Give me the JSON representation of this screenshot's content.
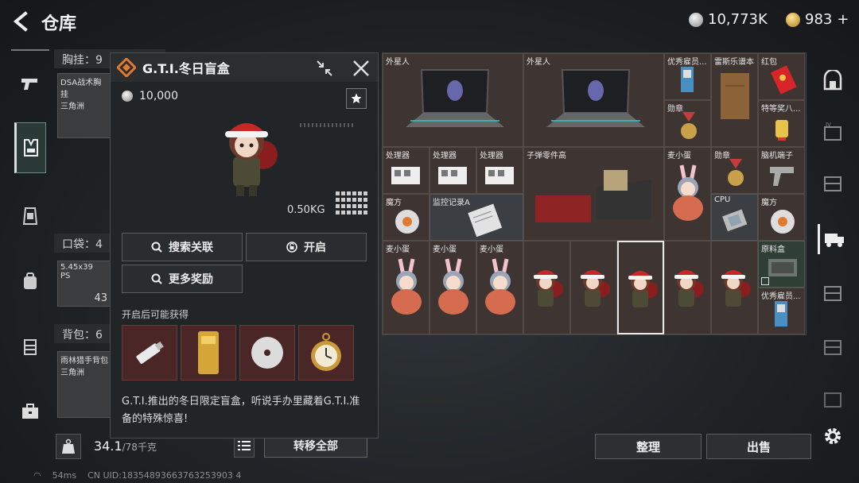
{
  "header": {
    "title": "仓库"
  },
  "currency": {
    "silver": "10,773K",
    "gold": "983",
    "plus": "+"
  },
  "equipment": {
    "chest_label": "胸挂：9",
    "chest_slot": "DSA战术胸挂\n三角洲",
    "pocket_label": "口袋：4",
    "pocket_slot": "5.45x39",
    "pocket_slot_sub": "PS",
    "pocket_count": "43",
    "backpack_label": "背包：6",
    "backpack_slot": "雨林猎手背包\n三角洲"
  },
  "popup": {
    "title": "G.T.I.冬日盲盒",
    "price": "10,000",
    "weight": "0.50KG",
    "search_related": "搜索关联",
    "open": "开启",
    "more_rewards": "更多奖励",
    "rewards_title": "开启后可能获得",
    "description": "G.T.I.推出的冬日限定盲盒，听说手办里藏着G.T.I.准备的特殊惊喜!",
    "rewards": [
      "usb-drive",
      "gold-bar",
      "disc",
      "pocket-watch"
    ]
  },
  "weight_bar": {
    "current": "34.1",
    "max": "/78千克",
    "transfer_all": "转移全部"
  },
  "status": {
    "ping": "54ms",
    "uid": "CN UID:18354893663763253903 4"
  },
  "warehouse": {
    "items": [
      {
        "label": "外星人"
      },
      {
        "label": "外星人"
      },
      {
        "label": "优秀雇员..."
      },
      {
        "label": "雷斯乐谱本"
      },
      {
        "label": "红包"
      },
      {
        "label": "勋章"
      },
      {
        "label": "特等奖八..."
      },
      {
        "label": "处理器"
      },
      {
        "label": "处理器"
      },
      {
        "label": "处理器"
      },
      {
        "label": "子弹零件高"
      },
      {
        "label": "麦小蛋"
      },
      {
        "label": "勋章"
      },
      {
        "label": "脑机端子"
      },
      {
        "label": "魔方"
      },
      {
        "label": "监控记录A"
      },
      {
        "label": "CPU"
      },
      {
        "label": "魔方"
      },
      {
        "label": "麦小蛋"
      },
      {
        "label": "麦小蛋"
      },
      {
        "label": "麦小蛋"
      },
      {
        "label": "原料盒"
      },
      {
        "label": "优秀雇员..."
      }
    ]
  },
  "actions": {
    "organize": "整理",
    "sell": "出售"
  },
  "colors": {
    "reward_bg": "#4a2626",
    "selected_border": "#e8e8e8",
    "gti_orange": "#e07a2e"
  }
}
